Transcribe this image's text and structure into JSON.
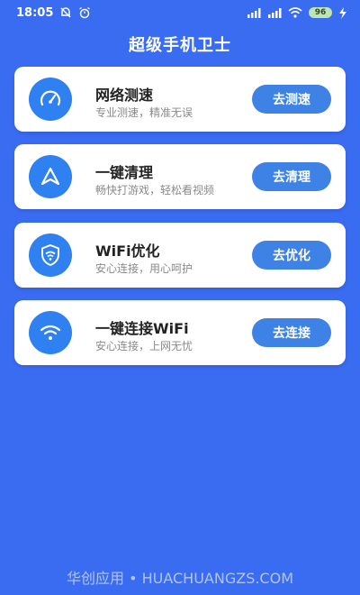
{
  "status_bar": {
    "time": "18:05",
    "battery": "96"
  },
  "header": {
    "title": "超级手机卫士"
  },
  "cards": [
    {
      "title": "网络测速",
      "subtitle": "专业测速，精准无误",
      "button": "去测速",
      "icon": "speedometer-icon"
    },
    {
      "title": "一键清理",
      "subtitle": "畅快打游戏，轻松看视频",
      "button": "去清理",
      "icon": "navigation-arrow-icon"
    },
    {
      "title": "WiFi优化",
      "subtitle": "安心连接，用心呵护",
      "button": "去优化",
      "icon": "shield-wifi-icon"
    },
    {
      "title": "一键连接WiFi",
      "subtitle": "安心连接，上网无忧",
      "button": "去连接",
      "icon": "wifi-icon"
    }
  ],
  "footer": {
    "watermark": "华创应用 • HUACHUANGZS.COM"
  },
  "colors": {
    "background": "#3a6cf2",
    "card": "#ffffff",
    "icon_circle": "#2f80f0",
    "button": "#3f82e6",
    "title_text": "#222222",
    "subtitle_text": "#8a8a8a"
  }
}
